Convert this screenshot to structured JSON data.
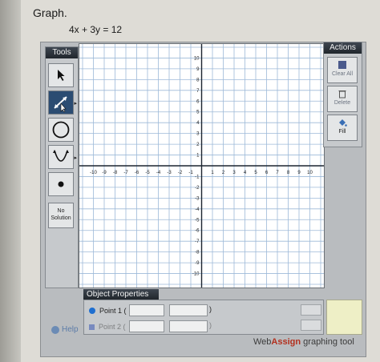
{
  "question": {
    "title": "Graph.",
    "equation": "4x + 3y = 12"
  },
  "tools": {
    "header": "Tools",
    "items": [
      {
        "name": "pointer",
        "icon": "arrow-pointer-icon"
      },
      {
        "name": "line",
        "icon": "line-tool-icon"
      },
      {
        "name": "circle",
        "icon": "circle-tool-icon"
      },
      {
        "name": "parabola",
        "icon": "parabola-tool-icon"
      },
      {
        "name": "point",
        "icon": "point-tool-icon"
      }
    ],
    "no_solution_line1": "No",
    "no_solution_line2": "Solution"
  },
  "graph": {
    "x_min": -10,
    "x_max": 10,
    "y_min": -10,
    "y_max": 10,
    "x_tick_labels": [
      "-10",
      "-9",
      "-8",
      "-7",
      "-6",
      "-5",
      "-4",
      "-3",
      "-2",
      "-1",
      "1",
      "2",
      "3",
      "4",
      "5",
      "6",
      "7",
      "8",
      "9",
      "10"
    ],
    "y_tick_labels": [
      "10",
      "9",
      "8",
      "7",
      "6",
      "5",
      "4",
      "3",
      "2",
      "1",
      "-1",
      "-2",
      "-3",
      "-4",
      "-5",
      "-6",
      "-7",
      "-8",
      "-9",
      "-10"
    ],
    "grid": true,
    "grid_color": "#9db9d8",
    "axis_color": "#1c2530"
  },
  "actions": {
    "header": "Actions",
    "clear_all": "Clear All",
    "delete": "Delete",
    "fill": "Fill"
  },
  "properties": {
    "header": "Object Properties",
    "point1_label": "Point 1 (",
    "point1_close": ")",
    "point2_label": "Point 2 (",
    "point2_close": ")",
    "point1_color": "#1f6fd0",
    "point2_color": "#1a3fb0"
  },
  "footer": {
    "help": "Help",
    "brand_web": "Web",
    "brand_assign": "Assign",
    "brand_rest": " graphing tool"
  }
}
